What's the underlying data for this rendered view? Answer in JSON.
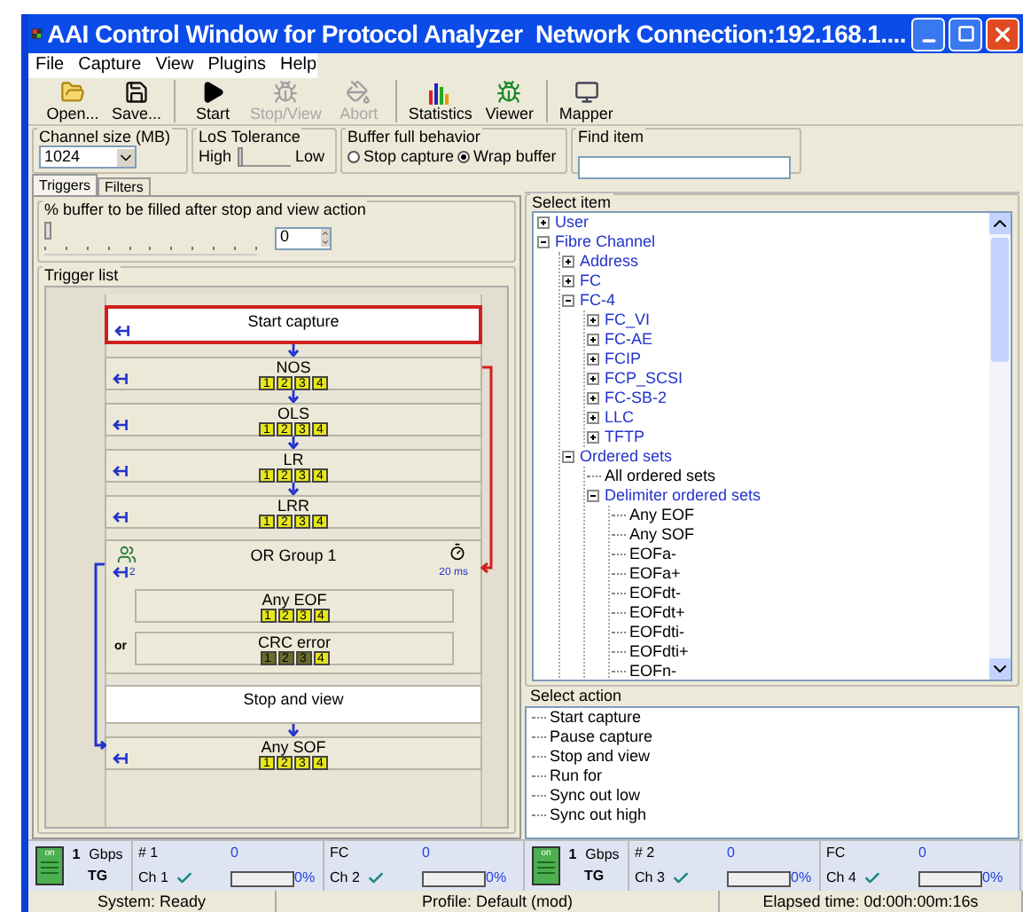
{
  "window": {
    "title": "AAI Control Window for Protocol Analyzer  Network Connection:192.168.1...."
  },
  "menu": [
    "File",
    "Capture",
    "View",
    "Plugins",
    "Help"
  ],
  "toolbar": {
    "groups": [
      {
        "buttons": [
          {
            "label": "Open...",
            "kind": "open",
            "disabled": false
          },
          {
            "label": "Save...",
            "kind": "save",
            "disabled": false
          }
        ]
      },
      {
        "buttons": [
          {
            "label": "Start",
            "kind": "start",
            "disabled": false
          },
          {
            "label": "Stop/View",
            "kind": "stop",
            "disabled": true
          },
          {
            "label": "Abort",
            "kind": "abort",
            "disabled": true
          }
        ]
      },
      {
        "buttons": [
          {
            "label": "Statistics",
            "kind": "statistics",
            "disabled": false
          },
          {
            "label": "Viewer",
            "kind": "viewer",
            "disabled": false
          }
        ]
      },
      {
        "buttons": [
          {
            "label": "Mapper",
            "kind": "mapper",
            "disabled": false
          }
        ]
      }
    ]
  },
  "options": {
    "channel_size": {
      "label": "Channel size (MB)",
      "value": "1024"
    },
    "los_tolerance": {
      "label": "LoS Tolerance",
      "high": "High",
      "low": "Low",
      "level": 0
    },
    "buffer_full": {
      "label": "Buffer full behavior",
      "options": [
        {
          "label": "Stop capture",
          "selected": false
        },
        {
          "label": "Wrap buffer",
          "selected": true
        }
      ]
    },
    "find_item": {
      "label": "Find item"
    }
  },
  "tabs": [
    {
      "label": "Triggers",
      "selected": true
    },
    {
      "label": "Filters",
      "selected": false
    }
  ],
  "buffer_fill": {
    "label": "% buffer to be filled after stop and view action",
    "level": 0,
    "value": "0"
  },
  "trigger_list": {
    "label": "Trigger list",
    "items": [
      {
        "kind": "action",
        "name": "Start capture",
        "selected": true
      },
      {
        "kind": "trigger",
        "name": "NOS",
        "selected": false,
        "ports": [
          {
            "label": "1",
            "active": true
          },
          {
            "label": "2",
            "active": true
          },
          {
            "label": "3",
            "active": true
          },
          {
            "label": "4",
            "active": true
          }
        ]
      },
      {
        "kind": "trigger",
        "name": "OLS",
        "selected": false,
        "ports": [
          {
            "label": "1",
            "active": true
          },
          {
            "label": "2",
            "active": true
          },
          {
            "label": "3",
            "active": true
          },
          {
            "label": "4",
            "active": true
          }
        ]
      },
      {
        "kind": "trigger",
        "name": "LR",
        "selected": false,
        "ports": [
          {
            "label": "1",
            "active": true
          },
          {
            "label": "2",
            "active": true
          },
          {
            "label": "3",
            "active": true
          },
          {
            "label": "4",
            "active": true
          }
        ]
      },
      {
        "kind": "trigger",
        "name": "LRR",
        "selected": false,
        "ports": [
          {
            "label": "1",
            "active": true
          },
          {
            "label": "2",
            "active": true
          },
          {
            "label": "3",
            "active": true
          },
          {
            "label": "4",
            "active": true
          }
        ]
      },
      {
        "kind": "group",
        "name": "OR Group 1",
        "selected": false,
        "timer": "20 ms",
        "jump": "2",
        "operator": "or",
        "children": [
          {
            "name": "Any EOF",
            "ports": [
              {
                "label": "1",
                "active": true
              },
              {
                "label": "2",
                "active": true
              },
              {
                "label": "3",
                "active": true
              },
              {
                "label": "4",
                "active": true
              }
            ]
          },
          {
            "name": "CRC error",
            "ports": [
              {
                "label": "1",
                "active": false
              },
              {
                "label": "2",
                "active": false
              },
              {
                "label": "3",
                "active": false
              },
              {
                "label": "4",
                "active": true
              }
            ]
          }
        ]
      },
      {
        "kind": "action",
        "name": "Stop and view",
        "selected": false
      },
      {
        "kind": "trigger",
        "name": "Any SOF",
        "selected": false,
        "ports": [
          {
            "label": "1",
            "active": true
          },
          {
            "label": "2",
            "active": true
          },
          {
            "label": "3",
            "active": true
          },
          {
            "label": "4",
            "active": true
          }
        ]
      }
    ]
  },
  "select_item": {
    "label": "Select item",
    "tree": [
      {
        "label": "User",
        "expanded": false
      },
      {
        "label": "Fibre Channel",
        "expanded": true,
        "children": [
          {
            "label": "Address",
            "expanded": false
          },
          {
            "label": "FC",
            "expanded": false
          },
          {
            "label": "FC-4",
            "expanded": true,
            "children": [
              {
                "label": "FC_VI",
                "expanded": false
              },
              {
                "label": "FC-AE",
                "expanded": false
              },
              {
                "label": "FCIP",
                "expanded": false
              },
              {
                "label": "FCP_SCSI",
                "expanded": false
              },
              {
                "label": "FC-SB-2",
                "expanded": false
              },
              {
                "label": "LLC",
                "expanded": false
              },
              {
                "label": "TFTP",
                "expanded": false
              }
            ]
          },
          {
            "label": "Ordered sets",
            "expanded": true,
            "children": [
              {
                "label": "All ordered sets"
              },
              {
                "label": "Delimiter ordered sets",
                "expanded": true,
                "children": [
                  {
                    "label": "Any EOF"
                  },
                  {
                    "label": "Any SOF"
                  },
                  {
                    "label": "EOFa-"
                  },
                  {
                    "label": "EOFa+"
                  },
                  {
                    "label": "EOFdt-"
                  },
                  {
                    "label": "EOFdt+"
                  },
                  {
                    "label": "EOFdti-"
                  },
                  {
                    "label": "EOFdti+"
                  },
                  {
                    "label": "EOFn-"
                  }
                ]
              }
            ]
          }
        ]
      }
    ]
  },
  "select_action": {
    "label": "Select action",
    "items": [
      "Start capture",
      "Pause capture",
      "Stop and view",
      "Run for",
      "Sync out low",
      "Sync out high"
    ]
  },
  "channel_bar": [
    {
      "on_label": "on",
      "speed": "1",
      "unit": "Gbps",
      "mode": "TG",
      "channels": [
        {
          "top": "# 1",
          "name": "Ch 1",
          "count": "0",
          "level": 0,
          "percent": "0%"
        },
        {
          "top": "FC",
          "name": "Ch 2",
          "count": "0",
          "level": 0,
          "percent": "0%"
        }
      ]
    },
    {
      "on_label": "on",
      "speed": "1",
      "unit": "Gbps",
      "mode": "TG",
      "channels": [
        {
          "top": "# 2",
          "name": "Ch 3",
          "count": "0",
          "level": 0,
          "percent": "0%"
        },
        {
          "top": "FC",
          "name": "Ch 4",
          "count": "0",
          "level": 0,
          "percent": "0%"
        }
      ]
    }
  ],
  "status_bar": [
    "System: Ready",
    "Profile: Default (mod)",
    "Elapsed time: 0d:00h:00m:16s"
  ]
}
